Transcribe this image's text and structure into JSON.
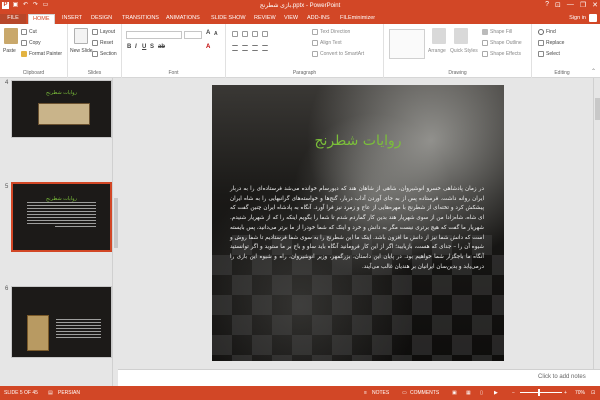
{
  "titlebar": {
    "title": "بازی شطرنج.pptx - PowerPoint",
    "help": "?",
    "minimize": "—",
    "restore": "❐",
    "close": "✕"
  },
  "tabs": {
    "file": "FILE",
    "items": [
      "HOME",
      "INSERT",
      "DESIGN",
      "TRANSITIONS",
      "ANIMATIONS",
      "SLIDE SHOW",
      "REVIEW",
      "VIEW",
      "ADD-INS",
      "FILEminimizer"
    ],
    "active": "HOME",
    "signin": "Sign in"
  },
  "ribbon": {
    "clipboard": {
      "label": "Clipboard",
      "paste": "Paste",
      "cut": "Cut",
      "copy": "Copy",
      "format_painter": "Format Painter"
    },
    "slides": {
      "label": "Slides",
      "new_slide": "New Slide",
      "layout": "Layout",
      "reset": "Reset",
      "section": "Section"
    },
    "font": {
      "label": "Font"
    },
    "paragraph": {
      "label": "Paragraph",
      "text_direction": "Text Direction",
      "align_text": "Align Text",
      "convert_smartart": "Convert to SmartArt"
    },
    "drawing": {
      "label": "Drawing",
      "arrange": "Arrange",
      "quick_styles": "Quick Styles",
      "shape_fill": "Shape Fill",
      "shape_outline": "Shape Outline",
      "shape_effects": "Shape Effects"
    },
    "editing": {
      "label": "Editing",
      "find": "Find",
      "replace": "Replace",
      "select": "Select"
    }
  },
  "thumbnails": [
    {
      "number": "4",
      "title": "روایات شطرنج",
      "selected": false
    },
    {
      "number": "5",
      "title": "روایات شطرنج",
      "selected": true
    },
    {
      "number": "6",
      "title": "",
      "selected": false
    }
  ],
  "slide": {
    "title": "روایات شطرنج",
    "body": "در زمان پادشاهی خسرو انوشیروان، شاهی از شاهان هند که دیورسام خوانده می‌شد فرستاده‌ای را به دربار ایران روانه داشت. فرستاده پس از به جای آوردن آداب دربار، گنج‌ها و خواسته‌های گرانبهایی را به شاه ایران پیشکش کرد و تخته‌ای از شطرنج با مهره‌هایی از عاج و زمرد نیز فرا آورد. آنگاه به پادشاه ایران چنین گفت که ای شاه، شاه‌زادا من از سوی شهریار هند بدین کار گماردم شدم تا شما را بگویم اینکه را که از شهریار شنیدم. شهریار ما گفت که هیچ برتری نیست مگر به دانش و خرد و اینک که شما خودرا از ما برتر می‌دانید، پس بایسته است که دانش شما نیز از دانش ما افزون باشد. اینک ما این شطرنج را به سوی شما فرستادیم تا شما روش و شیوه آن را – جدای که هست، بازیابید؛ اگر از این کار فرومانید آنگاه باید ساو و باج بر ما ستوید و اگر توانستید آنگاه ما باجگزار شما خواهیم بود. در پایان این داستان، بزرگمهر، وزیر انوشیروان، راه و شیوه این بازی را درمی‌یابد و بدین‌سان ایرانیان بر هندیان غالب می‌آیند."
  },
  "notes_placeholder": "Click to add notes",
  "status": {
    "slide_of": "SLIDE 5 OF 45",
    "language": "PERSIAN",
    "notes": "NOTES",
    "comments": "COMMENTS",
    "zoom": "70%"
  },
  "colors": {
    "accent": "#d24726",
    "slide_title": "#7bbf3a"
  }
}
